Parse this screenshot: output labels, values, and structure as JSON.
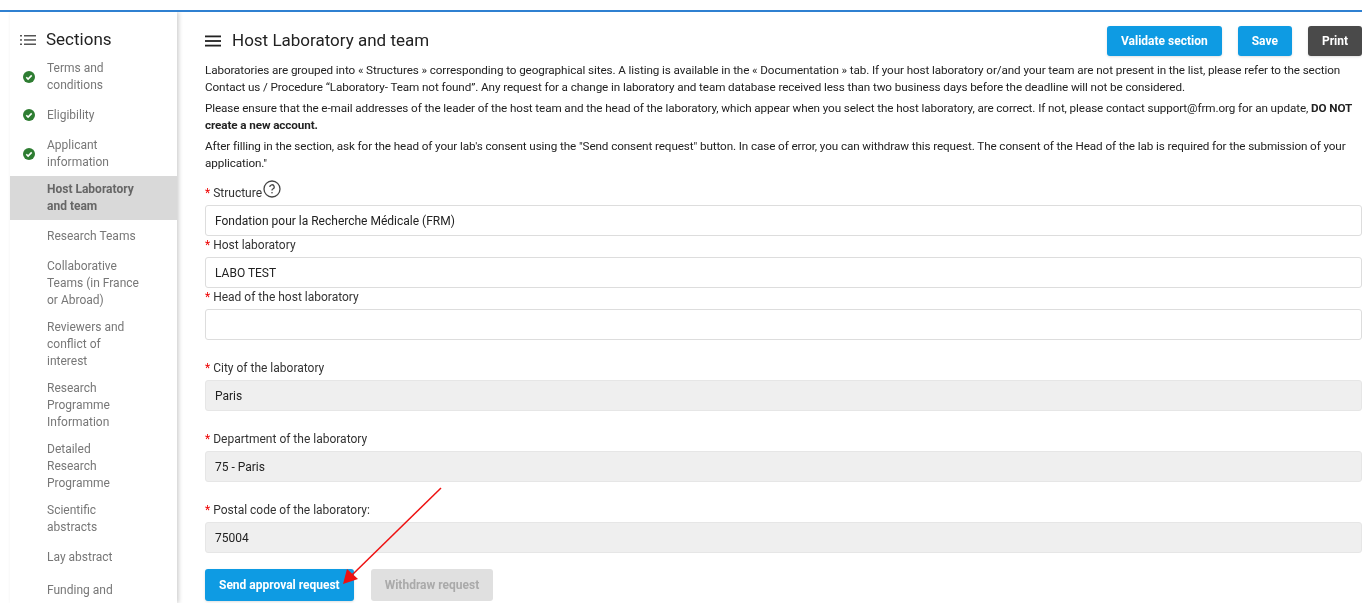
{
  "sidebar": {
    "title": "Sections",
    "items": [
      {
        "label": "Terms and conditions",
        "completed": true,
        "selected": false
      },
      {
        "label": "Eligibility",
        "completed": true,
        "selected": false
      },
      {
        "label": "Applicant information",
        "completed": true,
        "selected": false
      },
      {
        "label": "Host Laboratory and team",
        "completed": false,
        "selected": true
      },
      {
        "label": "Research Teams",
        "completed": false,
        "selected": false
      },
      {
        "label": "Collaborative Teams (in France or Abroad)",
        "completed": false,
        "selected": false
      },
      {
        "label": "Reviewers and conflict of interest",
        "completed": false,
        "selected": false
      },
      {
        "label": "Research Programme Information",
        "completed": false,
        "selected": false
      },
      {
        "label": "Detailed Research Programme",
        "completed": false,
        "selected": false
      },
      {
        "label": "Scientific abstracts",
        "completed": false,
        "selected": false
      },
      {
        "label": "Lay abstract",
        "completed": false,
        "selected": false
      },
      {
        "label": "Funding and",
        "completed": false,
        "selected": false
      }
    ]
  },
  "header": {
    "title": "Host Laboratory and team",
    "buttons": [
      {
        "label": "Validate section",
        "kind": "primary"
      },
      {
        "label": "Save",
        "kind": "primary"
      },
      {
        "label": "Print",
        "kind": "dark"
      }
    ]
  },
  "paragraphs": [
    "Laboratories are grouped into « Structures » corresponding to geographical sites. A listing is available in the « Documentation » tab. If your host laboratory or/and your team are not present in the list, please refer to the section Contact us / Procedure “Laboratory- Team not found”. Any request for a change in laboratory and team database received less than two business days before the deadline will not be considered.",
    "Please ensure that the e-mail addresses of the leader of the host team and the head of the laboratory, which appear when you select the host laboratory, are correct. If not, please contact support@frm.org for an update, **DO NOT create a new account.**",
    "After filling in the section, ask for the head of your lab's consent using the \"Send consent request\" button. In case of error, you can withdraw this request. The consent of the Head of the lab is required for the submission of your application.\""
  ],
  "fields": [
    {
      "label": "Structure",
      "required_mark": "*",
      "help": true,
      "value": "Fondation pour la Recherche Médicale (FRM)",
      "readonly": false
    },
    {
      "label": "Host laboratory",
      "required_mark": "*",
      "value": "LABO TEST",
      "readonly": false
    },
    {
      "label": "Head of the host laboratory",
      "required_mark": "*",
      "readonly": false
    },
    {
      "label": "City of the laboratory",
      "required_mark": "*",
      "value": "Paris",
      "readonly": true
    },
    {
      "label": "Department of the laboratory",
      "required_mark": "*",
      "value": "75 - Paris",
      "readonly": true
    },
    {
      "label": "Postal code of the laboratory:",
      "required_mark": "*",
      "value": "75004",
      "readonly": true
    }
  ],
  "actions": [
    {
      "label": "Send approval request",
      "disabled": false
    },
    {
      "label": "Withdraw request",
      "disabled": true
    }
  ]
}
